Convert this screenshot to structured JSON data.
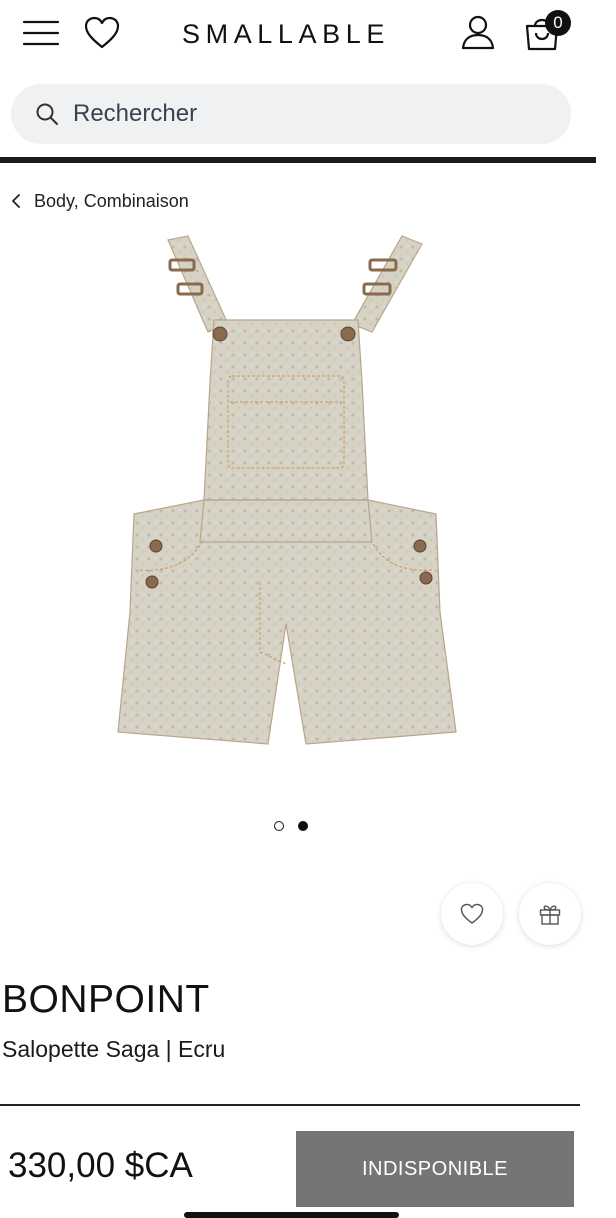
{
  "header": {
    "logo": "SMALLABLE",
    "cart_count": "0",
    "icons": [
      "menu-icon",
      "heart-icon",
      "user-icon",
      "shopping-bag-icon"
    ]
  },
  "search": {
    "placeholder": "Rechercher",
    "icon": "search-icon"
  },
  "breadcrumb": {
    "label": "Body, Combinaison",
    "icon": "chevron-left-icon"
  },
  "product": {
    "image": "overalls-product-image",
    "gallery": {
      "count": 2,
      "active_index": 1
    },
    "brand": "BONPOINT",
    "name": "Salopette Saga | Ecru",
    "price": "330,00 $CA",
    "cta_label": "INDISPONIBLE",
    "actions": [
      "heart-icon",
      "gift-icon"
    ]
  },
  "colors": {
    "accent": "#111111",
    "button_disabled": "#757575",
    "search_bg": "#f0f1f3"
  }
}
